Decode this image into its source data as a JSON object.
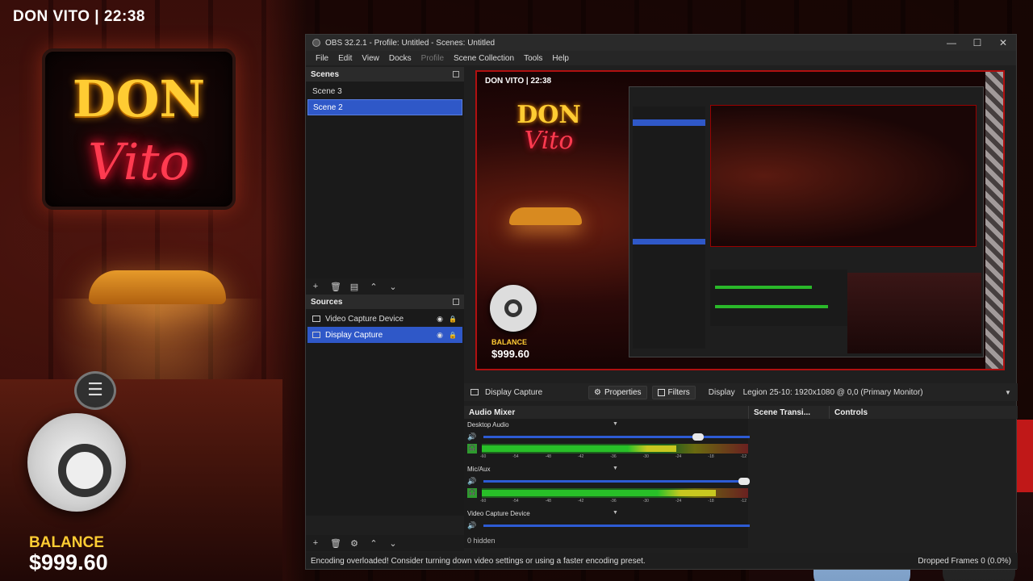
{
  "stream": {
    "title": "DON VITO | 22:38",
    "sign_line1": "DON",
    "sign_line2": "Vito",
    "balance_label": "BALANCE",
    "balance_value": "$999.60"
  },
  "window": {
    "title": "OBS 32.2.1 - Profile: Untitled - Scenes: Untitled",
    "controls": {
      "minimize": "—",
      "maximize": "☐",
      "close": "✕"
    }
  },
  "menu": {
    "items": [
      "File",
      "Edit",
      "View",
      "Docks",
      "Profile",
      "Scene Collection",
      "Tools",
      "Help"
    ]
  },
  "scenes": {
    "header": "Scenes",
    "items": [
      {
        "label": "Scene 3",
        "selected": false
      },
      {
        "label": "Scene 2",
        "selected": true
      }
    ],
    "toolbar_icons": [
      "plus-icon",
      "trash-icon",
      "filter-icon",
      "arrow-up-icon",
      "arrow-down-icon"
    ]
  },
  "sources": {
    "header": "Sources",
    "items": [
      {
        "label": "Video Capture Device",
        "selected": false
      },
      {
        "label": "Display Capture",
        "selected": true
      }
    ],
    "toolbar_icons": [
      "plus-icon",
      "trash-icon",
      "gear-icon",
      "arrow-up-icon",
      "arrow-down-icon"
    ]
  },
  "preview": {
    "title": "DON VITO | 22:38",
    "sign_line1": "DON",
    "sign_line2": "Vito",
    "balance_label": "BALANCE",
    "balance_value": "$999.60"
  },
  "context_bar": {
    "source_name": "Display Capture",
    "properties_label": "Properties",
    "filters_label": "Filters",
    "display_label": "Display",
    "display_value": "Legion 25-10: 1920x1080 @ 0,0 (Primary Monitor)"
  },
  "audio_mixer": {
    "header": "Audio Mixer",
    "tick_labels": [
      "-60",
      "-54",
      "-48",
      "-42",
      "-36",
      "-30",
      "-24",
      "-18",
      "-12"
    ],
    "channels": [
      {
        "name": "Desktop Audio",
        "volume": 0.82,
        "level": 0.73
      },
      {
        "name": "Mic/Aux",
        "volume": 1.0,
        "level": 0.88
      },
      {
        "name": "Video Capture Device",
        "volume": 1.0,
        "level": 0.0
      }
    ],
    "hidden": "0 hidden"
  },
  "docks": {
    "scene_transitions": "Scene Transi...",
    "controls": "Controls"
  },
  "status": {
    "message": "Encoding overloaded! Consider turning down video settings or using a faster encoding preset.",
    "dropped_frames": "Dropped Frames 0 (0.0%)"
  },
  "colors": {
    "selection": "#2f58c8",
    "meter_green": "#28c028",
    "preview_border": "#b01010",
    "gold": "#ffcc33",
    "neon_red": "#ff3b50"
  }
}
